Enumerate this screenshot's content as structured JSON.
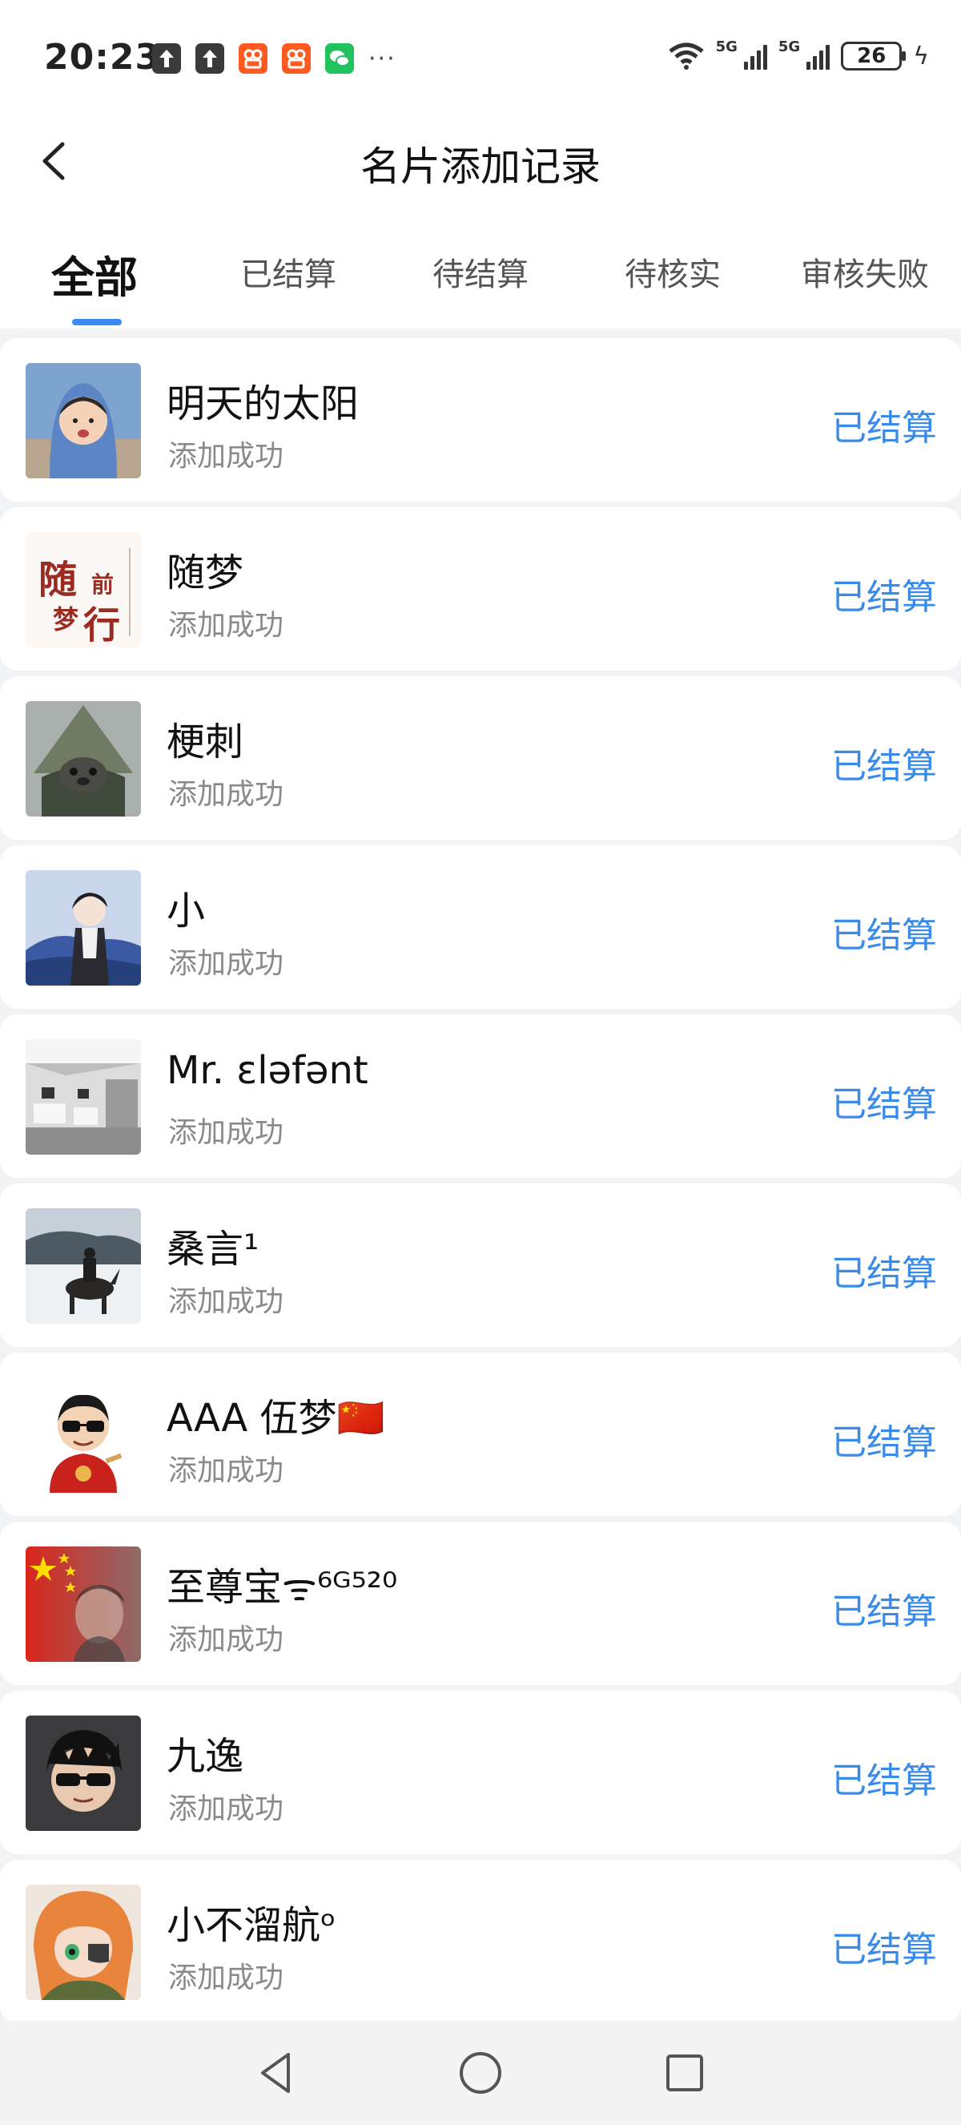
{
  "status_bar": {
    "time": "20:23",
    "left_icons": [
      "upload-icon",
      "upload-icon",
      "kuaishou-icon",
      "kuaishou-icon",
      "wechat-icon"
    ],
    "more": "···",
    "network_1": "5G",
    "network_2": "5G",
    "battery": "26"
  },
  "header": {
    "title": "名片添加记录"
  },
  "tabs": [
    {
      "label": "全部",
      "active": true
    },
    {
      "label": "已结算",
      "active": false
    },
    {
      "label": "待结算",
      "active": false
    },
    {
      "label": "待核实",
      "active": false
    },
    {
      "label": "审核失败",
      "active": false
    }
  ],
  "records": [
    {
      "name": "明天的太阳",
      "status": "添加成功",
      "settlement": "已结算"
    },
    {
      "name": "随梦",
      "status": "添加成功",
      "settlement": "已结算"
    },
    {
      "name": "梗刺",
      "status": "添加成功",
      "settlement": "已结算"
    },
    {
      "name": "小",
      "status": "添加成功",
      "settlement": "已结算"
    },
    {
      "name": "Mr. ɛləfənt",
      "status": "添加成功",
      "settlement": "已结算"
    },
    {
      "name": "桑言¹",
      "status": "添加成功",
      "settlement": "已结算"
    },
    {
      "name": "AAA 伍梦🇨🇳",
      "status": "添加成功",
      "settlement": "已结算"
    },
    {
      "name": "至尊宝ᯤ⁶ᴳ⁵²⁰",
      "status": "添加成功",
      "settlement": "已结算"
    },
    {
      "name": "九逸",
      "status": "添加成功",
      "settlement": "已结算"
    },
    {
      "name": "小不溜航ᵒ",
      "status": "添加成功",
      "settlement": "已结算"
    }
  ],
  "avatar_text": {
    "r2_a": "随",
    "r2_b": "前",
    "r2_c": "梦",
    "r2_d": "行"
  },
  "colors": {
    "accent": "#3a8ae8",
    "tab_indicator": "#3b8bf5",
    "muted_text": "#8a8a8a",
    "page_background": "#f2f3f5"
  },
  "nav": {
    "icons": [
      "back-triangle-icon",
      "home-circle-icon",
      "recents-square-icon"
    ]
  }
}
